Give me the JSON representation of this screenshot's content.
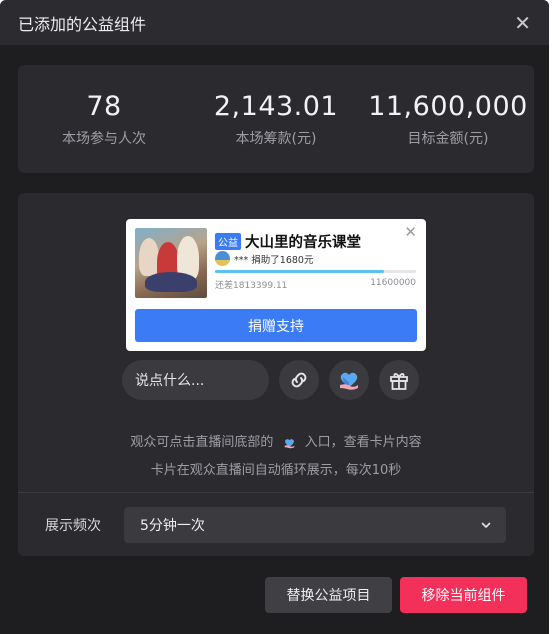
{
  "dialog": {
    "title": "已添加的公益组件",
    "close_label": "✕"
  },
  "stats": [
    {
      "value": "78",
      "label": "本场参与人次"
    },
    {
      "value": "2,143.01",
      "label": "本场筹款(元)"
    },
    {
      "value": "11,600,000",
      "label": "目标金额(元)"
    }
  ],
  "card": {
    "badge": "公益",
    "title": "大山里的音乐课堂",
    "donor_text": "*** 捐助了1680元",
    "remaining": "还差1813399.11",
    "target": "11600000",
    "progress": 0.84,
    "close_label": "✕",
    "donate_label": "捐赠支持"
  },
  "actions": {
    "input_placeholder": "说点什么...",
    "icons": [
      "link-icon",
      "heart-hand-icon",
      "gift-icon"
    ]
  },
  "info": {
    "line1_a": "观众可点击直播间底部的",
    "line1_b": "入口，查看卡片内容",
    "line2": "卡片在观众直播间自动循环展示，每次10秒"
  },
  "frequency": {
    "label": "展示频次",
    "selected": "5分钟一次"
  },
  "footer": {
    "replace_label": "替换公益项目",
    "remove_label": "移除当前组件"
  },
  "colors": {
    "background": "#1e1e21",
    "panel": "#2b2b2f",
    "accent_blue": "#3b7cf6",
    "danger": "#f2305a"
  }
}
